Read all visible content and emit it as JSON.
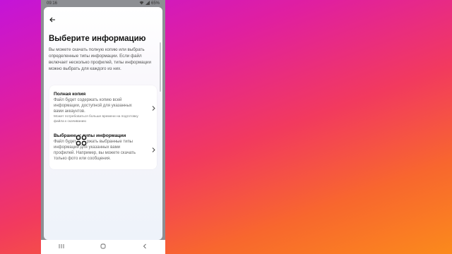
{
  "statusbar": {
    "time": "09:16",
    "battery": "65%"
  },
  "page": {
    "title": "Выберите информацию",
    "description": "Вы можете скачать полную копию или выбрать определенные типы информации. Если файл включает несколько профилей, типы информации можно выбрать для каждого из них."
  },
  "options": [
    {
      "title": "Полная копия",
      "subtitle": "Файл будет содержать копию всей информации, доступной для указанных вами аккаунтов.",
      "note": "Может потребоваться больше времени на подготовку файла к скачиванию"
    },
    {
      "title": "Выбранные типы информации",
      "subtitle": "Файл будет содержать выбранные типы информации для указанных вами профилей. Например, вы можете скачать только фото или сообщения."
    }
  ],
  "icons": {
    "back": "arrow-left-icon",
    "chevron": "chevron-right-icon",
    "overlay": "grid-icon",
    "nav": [
      "recents-icon",
      "home-icon",
      "back-icon"
    ]
  }
}
